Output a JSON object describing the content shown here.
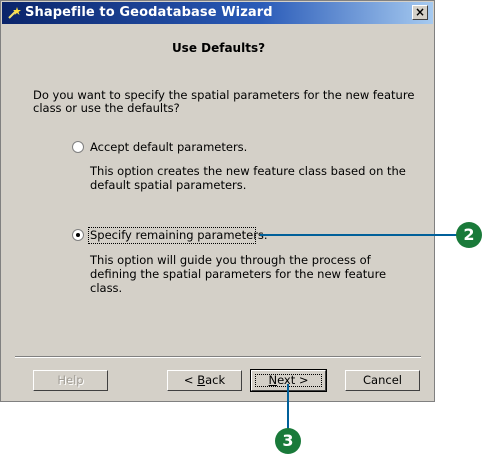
{
  "window": {
    "title": "Shapefile to Geodatabase Wizard",
    "close_symbol": "×"
  },
  "heading": "Use Defaults?",
  "question": "Do you want to specify the spatial parameters for the new feature class or use the defaults?",
  "options": [
    {
      "label": "Accept default parameters.",
      "description": "This option creates the new feature class based on the default spatial parameters.",
      "selected": false
    },
    {
      "label": "Specify remaining parameters.",
      "description": "This option will guide you through the process of defining the spatial parameters for the new feature class.",
      "selected": true
    }
  ],
  "buttons": {
    "help": "Help",
    "back_prefix": "< ",
    "back_mnemonic": "B",
    "back_rest": "ack",
    "next_mnemonic": "N",
    "next_rest": "ext >",
    "cancel": "Cancel"
  },
  "callouts": {
    "first": "2",
    "second": "3"
  }
}
